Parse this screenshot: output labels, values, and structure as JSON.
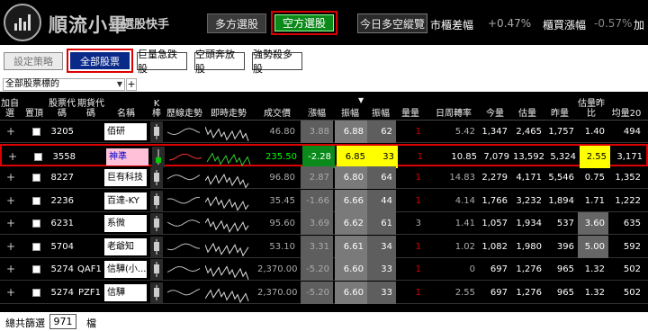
{
  "header": {
    "app_title": "順流小畢",
    "app_subtitle": "選股快手",
    "long_mode_label": "多方選股",
    "short_mode_label": "空方選股",
    "today_label": "今日多空縱覽",
    "market_diff_label": "市櫃差幅",
    "market_diff_value": "+0.47%",
    "otc_rise_label": "櫃買漲幅",
    "otc_rise_value": "-0.57%",
    "market_label": "加"
  },
  "toolbar": {
    "strategy_label": "設定策略",
    "tabs": [
      "全部股票",
      "巨量急跌股",
      "空頭奔放股",
      "強勢殺多股"
    ]
  },
  "filter": {
    "selected": "全部股票標的",
    "plus": "+"
  },
  "columns": [
    "加自選",
    "置頂",
    "股票代碼",
    "期貨代碼",
    "名稱",
    "K棒",
    "歷線走勢",
    "即時走勢",
    "成交價",
    "漲幅",
    "振幅",
    "振幅",
    "量量",
    "日周轉率",
    "今量",
    "估量",
    "昨量",
    "估量昨比",
    "均量20"
  ],
  "sort_indicator": "▼",
  "rows": [
    {
      "code": "3205",
      "fut": "",
      "name": "佰研",
      "price": "46.80",
      "chg": "3.88",
      "amp1": "6.88",
      "amp2": "62",
      "vq": "1",
      "turn": "5.42",
      "today": "1,347",
      "est": "2,465",
      "yest": "1,757",
      "ratio": "1.40",
      "avg": "494"
    },
    {
      "code": "3558",
      "fut": "",
      "name": "神準",
      "price": "235.50",
      "chg": "-2.28",
      "amp1": "6.85",
      "amp2": "33",
      "vq": "1",
      "turn": "10.85",
      "today": "7,079",
      "est": "13,592",
      "yest": "5,324",
      "ratio": "2.55",
      "avg": "3,171"
    },
    {
      "code": "8227",
      "fut": "",
      "name": "巨有科技",
      "price": "96.80",
      "chg": "2.87",
      "amp1": "6.80",
      "amp2": "64",
      "vq": "1",
      "turn": "14.83",
      "today": "2,279",
      "est": "4,171",
      "yest": "5,546",
      "ratio": "0.75",
      "avg": "1,352"
    },
    {
      "code": "2236",
      "fut": "",
      "name": "百達-KY",
      "price": "35.45",
      "chg": "-1.66",
      "amp1": "6.66",
      "amp2": "44",
      "vq": "1",
      "turn": "4.14",
      "today": "1,766",
      "est": "3,232",
      "yest": "1,894",
      "ratio": "1.71",
      "avg": "1,222"
    },
    {
      "code": "6231",
      "fut": "",
      "name": "系微",
      "price": "95.60",
      "chg": "3.69",
      "amp1": "6.62",
      "amp2": "61",
      "vq": "3",
      "turn": "1.41",
      "today": "1,057",
      "est": "1,934",
      "yest": "537",
      "ratio": "3.60",
      "avg": "635"
    },
    {
      "code": "5704",
      "fut": "",
      "name": "老爺知",
      "price": "53.10",
      "chg": "3.31",
      "amp1": "6.61",
      "amp2": "34",
      "vq": "1",
      "turn": "1.02",
      "today": "1,082",
      "est": "1,980",
      "yest": "396",
      "ratio": "5.00",
      "avg": "592"
    },
    {
      "code": "5274",
      "fut": "QAF1",
      "name": "信驊(小...",
      "price": "2,370.00",
      "chg": "-5.20",
      "amp1": "6.60",
      "amp2": "33",
      "vq": "1",
      "turn": "0",
      "today": "697",
      "est": "1,276",
      "yest": "965",
      "ratio": "1.32",
      "avg": "502"
    },
    {
      "code": "5274",
      "fut": "PZF1",
      "name": "信驊",
      "price": "2,370.00",
      "chg": "-5.20",
      "amp1": "6.60",
      "amp2": "33",
      "vq": "1",
      "turn": "2.55",
      "today": "697",
      "est": "1,276",
      "yest": "965",
      "ratio": "1.32",
      "avg": "502"
    }
  ],
  "footer": {
    "label": "總共篩選",
    "count": "971",
    "unit": "檔"
  },
  "colors": {
    "highlight_border": "#dd0000",
    "short_mode_bg": "#0b8a1a",
    "active_tab_bg": "#0a2a8a",
    "yellow": "#ffff00",
    "up": "#ff3333",
    "down": "#33cc33"
  }
}
